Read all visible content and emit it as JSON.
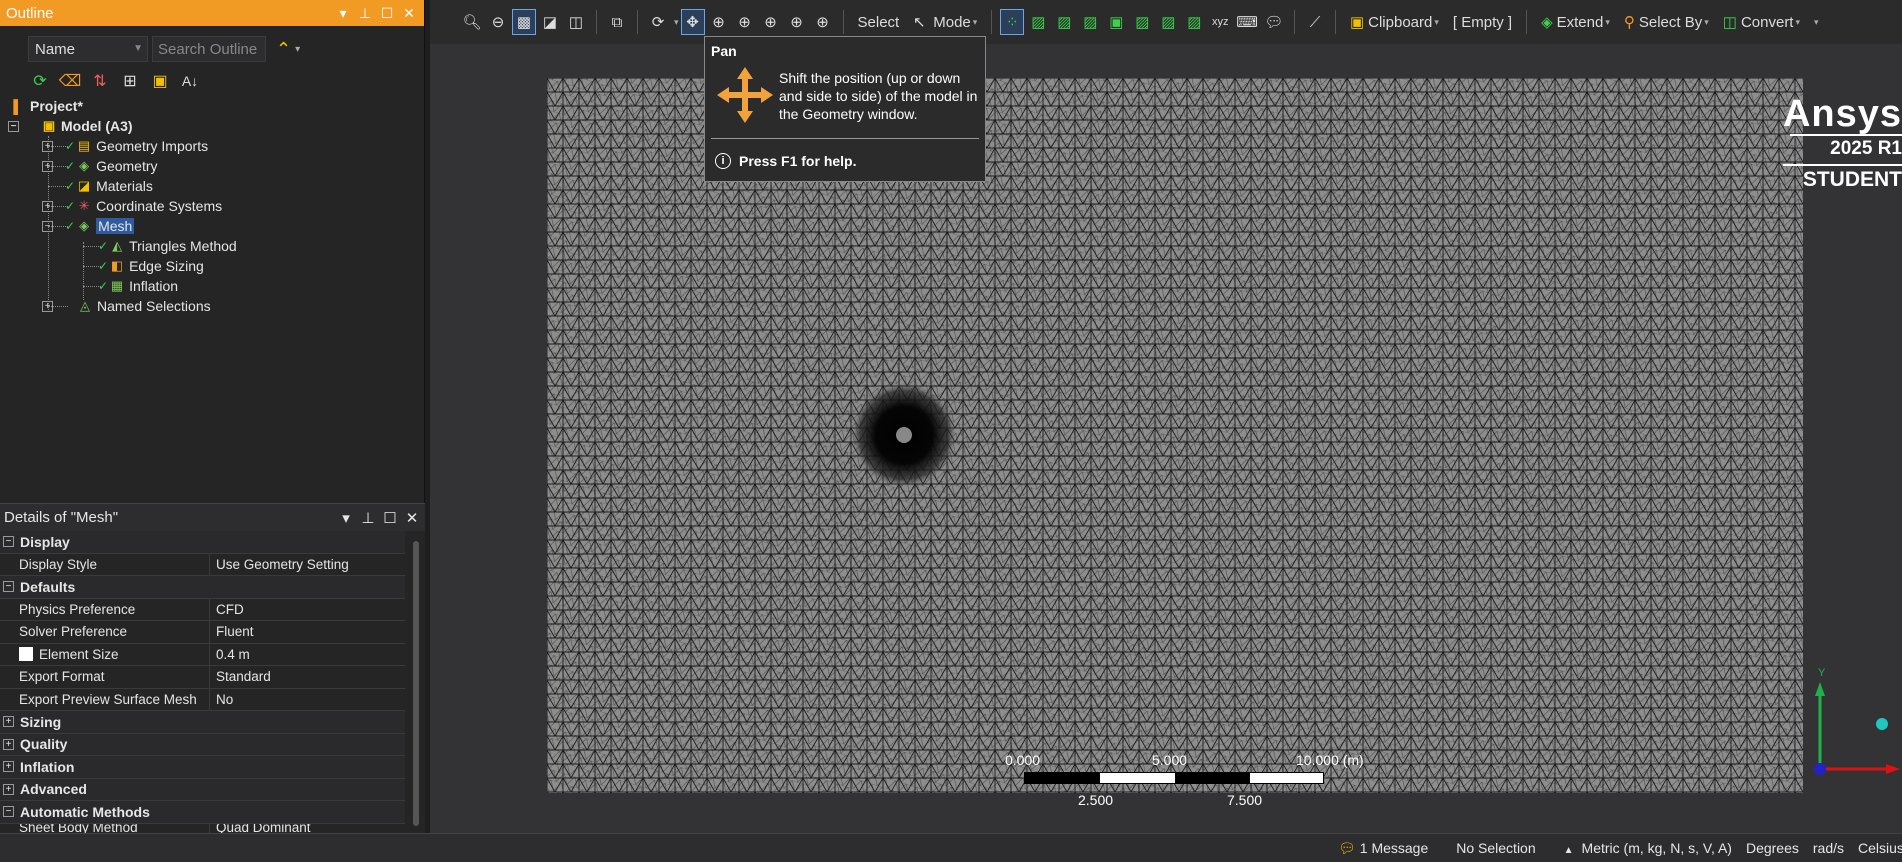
{
  "outline": {
    "title": "Outline",
    "filter_select": "Name",
    "search_placeholder": "Search Outline",
    "tree": {
      "project": "Project*",
      "model": "Model (A3)",
      "geometry_imports": "Geometry Imports",
      "geometry": "Geometry",
      "materials": "Materials",
      "coordinate_systems": "Coordinate Systems",
      "mesh": "Mesh",
      "triangles_method": "Triangles Method",
      "edge_sizing": "Edge Sizing",
      "inflation": "Inflation",
      "named_selections": "Named Selections"
    }
  },
  "details": {
    "title": "Details of \"Mesh\"",
    "groups": {
      "display": "Display",
      "defaults": "Defaults",
      "sizing": "Sizing",
      "quality": "Quality",
      "inflation": "Inflation",
      "advanced": "Advanced",
      "automatic_methods": "Automatic Methods"
    },
    "rows": {
      "display_style": [
        "Display Style",
        "Use Geometry Setting"
      ],
      "physics_preference": [
        "Physics Preference",
        "CFD"
      ],
      "solver_preference": [
        "Solver Preference",
        "Fluent"
      ],
      "element_size": [
        "Element Size",
        "0.4 m"
      ],
      "export_format": [
        "Export Format",
        "Standard"
      ],
      "export_preview": [
        "Export Preview Surface Mesh",
        "No"
      ],
      "sheet_body": [
        "Sheet Body Method",
        "Quad Dominant"
      ]
    }
  },
  "toolbar": {
    "select": "Select",
    "mode": "Mode",
    "clipboard": "Clipboard",
    "empty": "[ Empty ]",
    "extend": "Extend",
    "select_by": "Select By",
    "convert": "Convert"
  },
  "tooltip": {
    "title": "Pan",
    "description": "Shift the position (up or down and side to side) of the model in the Geometry window.",
    "help": "Press F1 for help."
  },
  "logo": {
    "brand": "Ansys",
    "version": "2025 R1",
    "edition": "STUDENT"
  },
  "scale_bar": {
    "top_labels": [
      "0.000",
      "5.000",
      "10.000 (m)"
    ],
    "bottom_labels": [
      "2.500",
      "7.500"
    ]
  },
  "triad": {
    "y_label": "Y"
  },
  "status": {
    "messages": "1 Message",
    "selection": "No Selection",
    "units": "Metric (m, kg, N, s, V, A)",
    "angle": "Degrees",
    "rotation": "rad/s",
    "temperature": "Celsius"
  },
  "colors": {
    "accent": "#f29b24",
    "mesh_fill": "#8d8d8d",
    "check": "#3bd24a"
  }
}
